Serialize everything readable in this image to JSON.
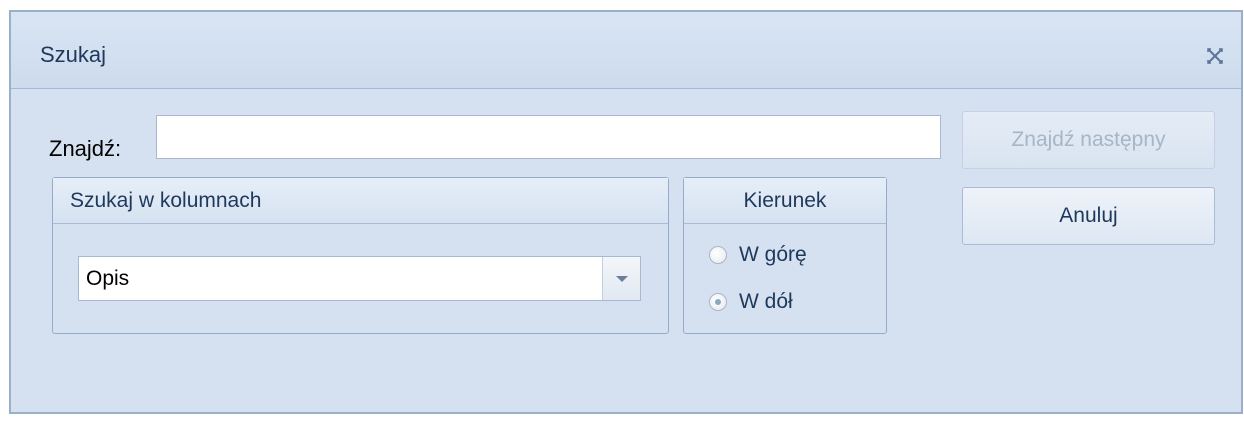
{
  "dialog": {
    "title": "Szukaj",
    "close_icon": "close-icon"
  },
  "find": {
    "label": "Znajdź:",
    "value": "",
    "placeholder": ""
  },
  "buttons": {
    "find_next": "Znajdź następny",
    "find_next_enabled": false,
    "cancel": "Anuluj"
  },
  "search_columns": {
    "title": "Szukaj w kolumnach",
    "selected": "Opis"
  },
  "direction": {
    "title": "Kierunek",
    "options": [
      {
        "label": "W górę",
        "checked": false
      },
      {
        "label": "W dół",
        "checked": true
      }
    ]
  },
  "colors": {
    "background": "#d5e1f0",
    "title_text": "#1e395b",
    "border": "#9aafc8"
  }
}
